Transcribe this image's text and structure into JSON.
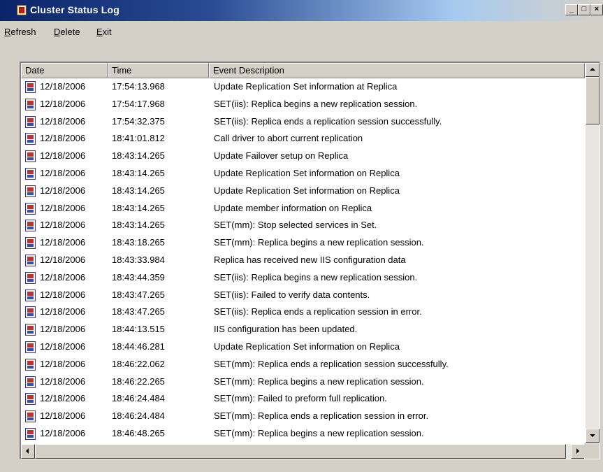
{
  "window": {
    "title": "Cluster Status Log",
    "controls": [
      "_",
      "□",
      "×"
    ]
  },
  "menu": [
    {
      "label": "Refresh",
      "mnemonic": "R",
      "rest": "efresh"
    },
    {
      "label": "Delete",
      "mnemonic": "D",
      "rest": "elete"
    },
    {
      "label": "Exit",
      "mnemonic": "E",
      "rest": "xit"
    }
  ],
  "columns": [
    "Date",
    "Time",
    "Event Description"
  ],
  "rows": [
    {
      "date": "12/18/2006",
      "time": "17:54:13.968",
      "desc": "Update Replication Set information at Replica"
    },
    {
      "date": "12/18/2006",
      "time": "17:54:17.968",
      "desc": "SET(iis): Replica begins a new replication session."
    },
    {
      "date": "12/18/2006",
      "time": "17:54:32.375",
      "desc": "SET(iis): Replica ends a replication session successfully."
    },
    {
      "date": "12/18/2006",
      "time": "18:41:01.812",
      "desc": "Call driver to abort current replication"
    },
    {
      "date": "12/18/2006",
      "time": "18:43:14.265",
      "desc": "Update Failover setup on Replica"
    },
    {
      "date": "12/18/2006",
      "time": "18:43:14.265",
      "desc": "Update Replication Set information on Replica"
    },
    {
      "date": "12/18/2006",
      "time": "18:43:14.265",
      "desc": "Update Replication Set information on Replica"
    },
    {
      "date": "12/18/2006",
      "time": "18:43:14.265",
      "desc": "Update member information on Replica"
    },
    {
      "date": "12/18/2006",
      "time": "18:43:14.265",
      "desc": "SET(mm): Stop selected services in Set."
    },
    {
      "date": "12/18/2006",
      "time": "18:43:18.265",
      "desc": "SET(mm): Replica begins a new replication session."
    },
    {
      "date": "12/18/2006",
      "time": "18:43:33.984",
      "desc": "Replica has received new IIS configuration data"
    },
    {
      "date": "12/18/2006",
      "time": "18:43:44.359",
      "desc": "SET(iis): Replica begins a new replication session."
    },
    {
      "date": "12/18/2006",
      "time": "18:43:47.265",
      "desc": "SET(iis): Failed to verify data contents."
    },
    {
      "date": "12/18/2006",
      "time": "18:43:47.265",
      "desc": "SET(iis): Replica ends a replication session in error."
    },
    {
      "date": "12/18/2006",
      "time": "18:44:13.515",
      "desc": "IIS configuration has been updated."
    },
    {
      "date": "12/18/2006",
      "time": "18:44:46.281",
      "desc": "Update Replication Set information on Replica"
    },
    {
      "date": "12/18/2006",
      "time": "18:46:22.062",
      "desc": "SET(mm): Replica ends a replication session successfully."
    },
    {
      "date": "12/18/2006",
      "time": "18:46:22.265",
      "desc": "SET(mm): Replica begins a new replication session."
    },
    {
      "date": "12/18/2006",
      "time": "18:46:24.484",
      "desc": "SET(mm): Failed to preform full replication."
    },
    {
      "date": "12/18/2006",
      "time": "18:46:24.484",
      "desc": "SET(mm): Replica ends a replication session in error."
    },
    {
      "date": "12/18/2006",
      "time": "18:46:48.265",
      "desc": "SET(mm): Replica begins a new replication session."
    }
  ],
  "row_icon": "event-log-icon"
}
